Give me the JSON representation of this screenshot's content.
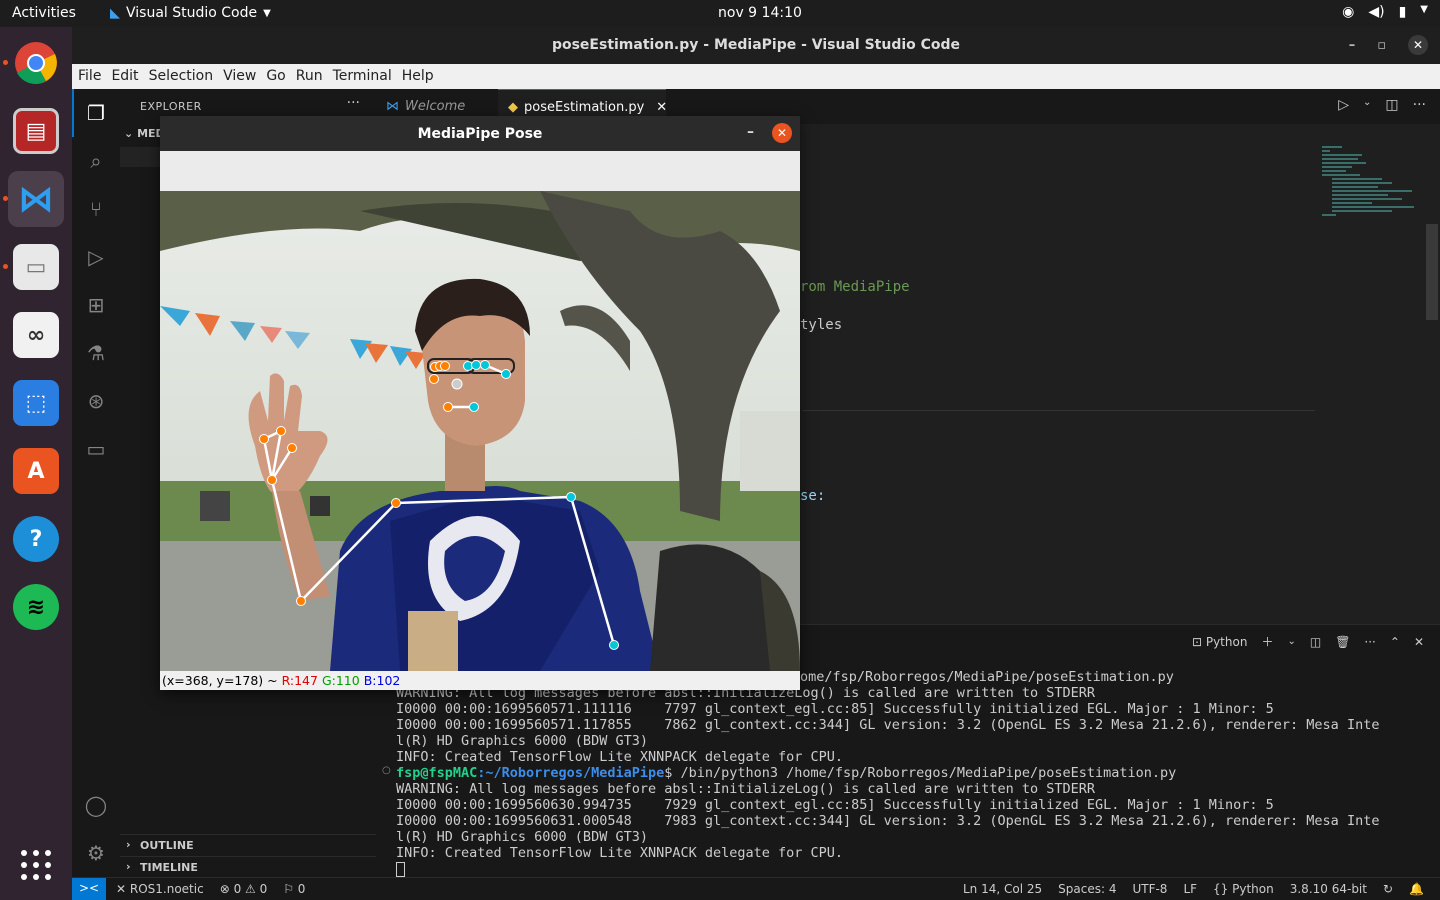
{
  "topbar": {
    "activities": "Activities",
    "app_name": "Visual Studio Code",
    "clock": "nov 9  14:10"
  },
  "window": {
    "title": "poseEstimation.py - MediaPipe - Visual Studio Code"
  },
  "menu": [
    "File",
    "Edit",
    "Selection",
    "View",
    "Go",
    "Run",
    "Terminal",
    "Help"
  ],
  "sidebar": {
    "header": "EXPLORER",
    "folder": "MEDI",
    "outline": "OUTLINE",
    "timeline": "TIMELINE"
  },
  "tabs": [
    {
      "label": "Welcome"
    },
    {
      "label": "poseEstimation.py"
    }
  ],
  "editor": {
    "frag1": "rom MediaPipe",
    "frag2": "tyles",
    "frag3": "se:"
  },
  "panel": {
    "shell_label": "Python"
  },
  "terminal": {
    "line0": "ome/fsp/Roborregos/MediaPipe/poseEstimation.py",
    "line1": "WARNING: All log messages before absl::InitializeLog() is called are written to STDERR",
    "line2": "I0000 00:00:1699560571.111116    7797 gl_context_egl.cc:85] Successfully initialized EGL. Major : 1 Minor: 5",
    "line3": "I0000 00:00:1699560571.117855    7862 gl_context.cc:344] GL version: 3.2 (OpenGL ES 3.2 Mesa 21.2.6), renderer: Mesa Inte",
    "line4": "l(R) HD Graphics 6000 (BDW GT3)",
    "line5": "INFO: Created TensorFlow Lite XNNPACK delegate for CPU.",
    "prompt_user": "fsp@fspMAC",
    "prompt_path": ":~/Roborregos/MediaPipe",
    "prompt_cmd": "$ /bin/python3 /home/fsp/Roborregos/MediaPipe/poseEstimation.py",
    "line7": "WARNING: All log messages before absl::InitializeLog() is called are written to STDERR",
    "line8": "I0000 00:00:1699560630.994735    7929 gl_context_egl.cc:85] Successfully initialized EGL. Major : 1 Minor: 5",
    "line9": "I0000 00:00:1699560631.000548    7983 gl_context.cc:344] GL version: 3.2 (OpenGL ES 3.2 Mesa 21.2.6), renderer: Mesa Inte",
    "line10": "l(R) HD Graphics 6000 (BDW GT3)",
    "line11": "INFO: Created TensorFlow Lite XNNPACK delegate for CPU."
  },
  "statusbar": {
    "remote": "><",
    "workspace": "ROS1.noetic",
    "problems": "⊗ 0 ⚠ 0",
    "ports": "⚐ 0",
    "position": "Ln 14, Col 25",
    "spaces": "Spaces: 4",
    "encoding": "UTF-8",
    "eol": "LF",
    "language": "Python",
    "interpreter": "3.8.10 64-bit"
  },
  "mediapipe": {
    "title": "MediaPipe Pose",
    "status_coords": "(x=368, y=178) ~ ",
    "status_r": "R:147",
    "status_g": "G:110",
    "status_b": "B:102"
  },
  "colors": {
    "accent": "#0078d4",
    "ubuntu_orange": "#e95420",
    "landmark_left": "#ff8000",
    "landmark_right": "#00c8d8"
  }
}
